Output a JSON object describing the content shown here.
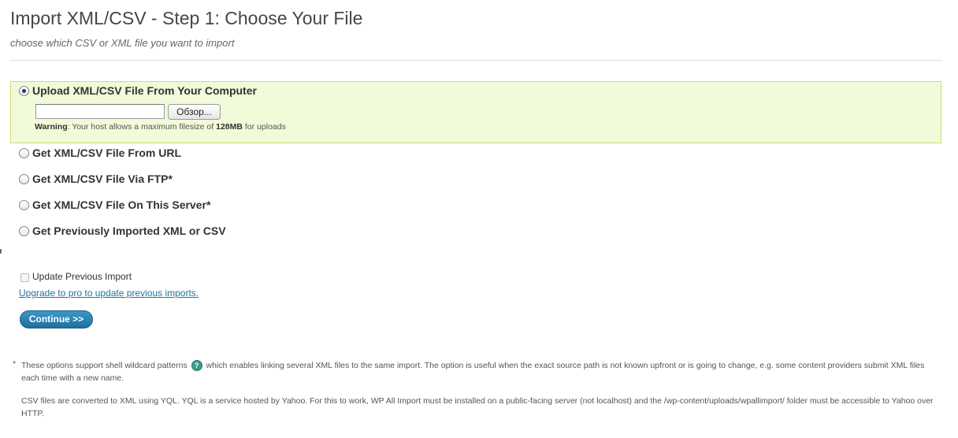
{
  "header": {
    "title": "Import XML/CSV - Step 1: Choose Your File",
    "subtitle": "choose which CSV or XML file you want to import"
  },
  "options": [
    {
      "label": "Upload XML/CSV File From Your Computer",
      "selected": true
    },
    {
      "label": "Get XML/CSV File From URL",
      "selected": false
    },
    {
      "label": "Get XML/CSV File Via FTP*",
      "selected": false
    },
    {
      "label": "Get XML/CSV File On This Server*",
      "selected": false
    },
    {
      "label": "Get Previously Imported XML or CSV",
      "selected": false
    }
  ],
  "upload": {
    "file_value": "",
    "browse_label": "Обзор...",
    "warning_prefix": "Warning",
    "warning_text_1": ": Your host allows a maximum filesize of ",
    "warning_size": "128MB",
    "warning_text_2": " for uploads"
  },
  "update_previous": {
    "label": "Update Previous Import",
    "checked": false,
    "upgrade_link": "Upgrade to pro to update previous imports."
  },
  "continue_label": "Continue >>",
  "footnotes": {
    "star": "*",
    "wildcard_part1": "These options support shell wildcard patterns",
    "help_icon_glyph": "?",
    "wildcard_part2": "which enables linking several XML files to the same import. The option is useful when the exact source path is not known upfront or is going to change, e.g. some content providers submit XML files each time with a new name.",
    "csv_note": "CSV files are converted to XML using YQL. YQL is a service hosted by Yahoo. For this to work, WP All Import must be installed on a public-facing server (not localhost) and the /wp-content/uploads/wpallimport/ folder must be accessible to Yahoo over HTTP."
  },
  "icons": {
    "help": "help-icon",
    "radio_selected": "radio-selected-icon"
  },
  "colors": {
    "selected_panel_bg": "#f1fad9",
    "selected_panel_border": "#c6e36b",
    "link": "#21759b",
    "button": "#2a82b3"
  }
}
